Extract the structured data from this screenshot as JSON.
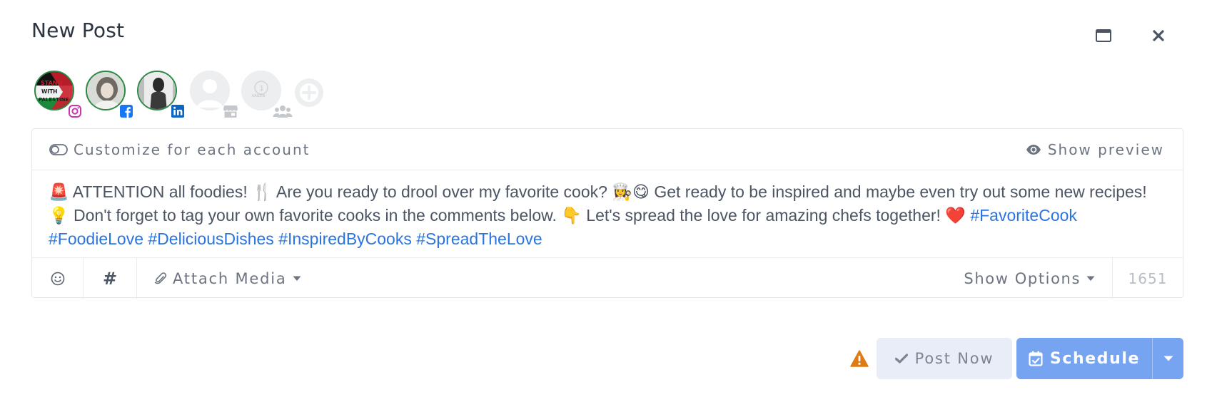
{
  "modal": {
    "title": "New Post"
  },
  "accounts": [
    {
      "name": "instagram-account",
      "network": "Instagram",
      "badge_color": "#c837ab",
      "avatar_text": [
        "STAND",
        "WITH",
        "PALESTINE"
      ]
    },
    {
      "name": "facebook-account",
      "network": "Facebook",
      "badge_color": "#1877f2"
    },
    {
      "name": "linkedin-account",
      "network": "LinkedIn",
      "badge_color": "#0a66c2"
    },
    {
      "name": "gmb-account",
      "network": "Google Business",
      "badge_color": "#c4c8cd"
    },
    {
      "name": "group-account",
      "network": "Groups",
      "badge_color": "#c4c8cd",
      "avatar_text": [
        "1",
        "KAIZEN"
      ]
    }
  ],
  "composer": {
    "customize_label": "Customize for each account",
    "preview_label": "Show preview",
    "text_parts": [
      "🚨 ATTENTION all foodies! 🍴 Are you ready to drool over my favorite cook? 👩‍🍳😋 Get ready to be inspired and maybe even try out some new recipes! 💡 Don't forget to tag your own favorite cooks in the comments below. 👇 Let's spread the love for amazing chefs together! ❤️"
    ],
    "hashtags": [
      "#FavoriteCook",
      "#FoodieLove",
      "#DeliciousDishes",
      "#InspiredByCooks",
      "#SpreadTheLove"
    ]
  },
  "toolbar": {
    "hash_label": "#",
    "attach_label": "Attach Media",
    "options_label": "Show Options",
    "char_count": "1651"
  },
  "actions": {
    "post_now_label": "Post Now",
    "schedule_label": "Schedule"
  },
  "colors": {
    "accent": "#76a4f0",
    "hashtag": "#2a74e0",
    "warning": "#e07b14"
  }
}
